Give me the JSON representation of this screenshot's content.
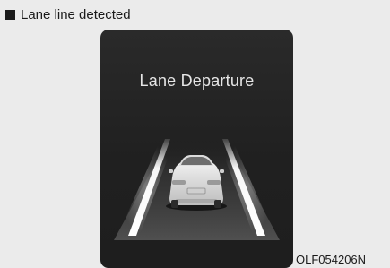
{
  "caption": {
    "bullet_icon": "square-bullet-icon",
    "text": "Lane line detected"
  },
  "cluster": {
    "title": "Lane Departure"
  },
  "image_code": "OLF054206N"
}
